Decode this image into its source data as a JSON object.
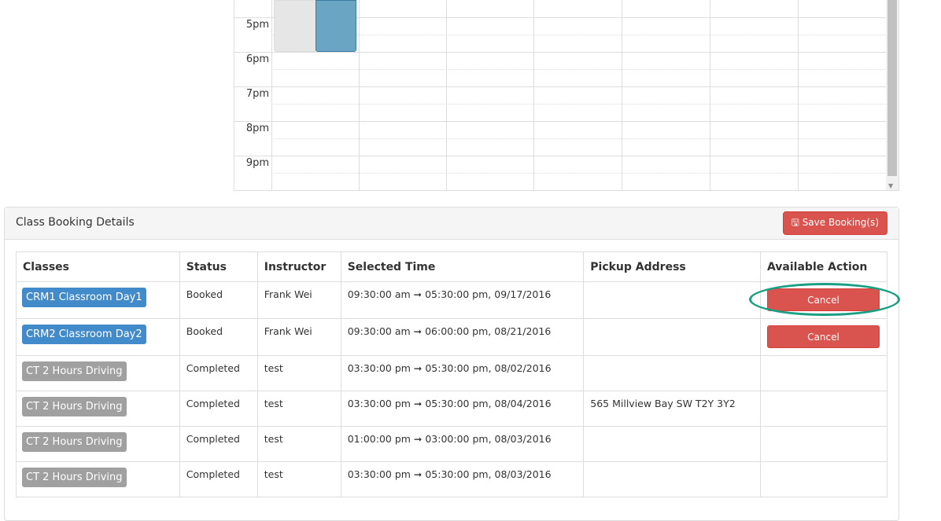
{
  "calendar": {
    "times": [
      "5pm",
      "6pm",
      "7pm",
      "8pm",
      "9pm"
    ],
    "event_colors": {
      "gray": "#e6e6e6",
      "blue": "#6aa6c4"
    }
  },
  "panel": {
    "title": "Class Booking Details",
    "save_label": "Save Booking(s)",
    "save_icon": "floppy-disk-icon"
  },
  "table": {
    "headers": [
      "Classes",
      "Status",
      "Instructor",
      "Selected Time",
      "Pickup Address",
      "Available Action"
    ],
    "rows": [
      {
        "class": "CRM1 Classroom Day1",
        "color": "#428bca",
        "status": "Booked",
        "instructor": "Frank Wei",
        "time": "09:30:00 am ➞ 05:30:00 pm, 09/17/2016",
        "address": "",
        "action": "Cancel"
      },
      {
        "class": "CRM2 Classroom Day2",
        "color": "#428bca",
        "status": "Booked",
        "instructor": "Frank Wei",
        "time": "09:30:00 am ➞ 06:00:00 pm, 08/21/2016",
        "address": "",
        "action": "Cancel"
      },
      {
        "class": "CT 2 Hours Driving",
        "color": "#a0a0a0",
        "status": "Completed",
        "instructor": "test",
        "time": "03:30:00 pm ➞ 05:30:00 pm, 08/02/2016",
        "address": "",
        "action": ""
      },
      {
        "class": "CT 2 Hours Driving",
        "color": "#a0a0a0",
        "status": "Completed",
        "instructor": "test",
        "time": "03:30:00 pm ➞ 05:30:00 pm, 08/04/2016",
        "address": "565 Millview Bay SW T2Y 3Y2",
        "action": ""
      },
      {
        "class": "CT 2 Hours Driving",
        "color": "#a0a0a0",
        "status": "Completed",
        "instructor": "test",
        "time": "01:00:00 pm ➞ 03:00:00 pm, 08/03/2016",
        "address": "",
        "action": ""
      },
      {
        "class": "CT 2 Hours Driving",
        "color": "#a0a0a0",
        "status": "Completed",
        "instructor": "test",
        "time": "03:30:00 pm ➞ 05:30:00 pm, 08/03/2016",
        "address": "",
        "action": ""
      }
    ]
  }
}
